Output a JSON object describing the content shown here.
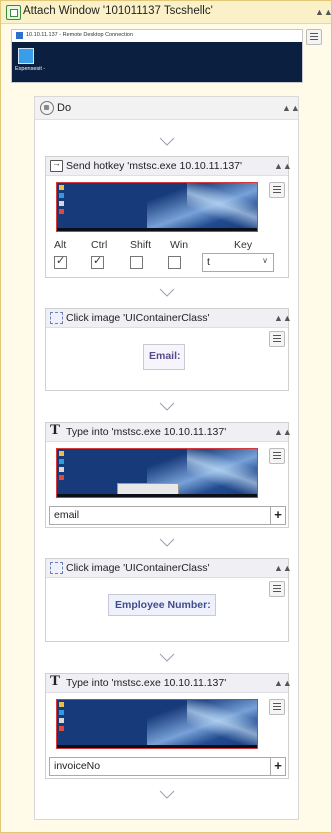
{
  "attach_window": {
    "title": "Attach Window '101011137 Tscshellc'",
    "rdp": {
      "window_title": "10.10.11.137 - Remote Desktop Connection",
      "app_label": "Expensesit -"
    }
  },
  "do": {
    "title": "Do",
    "send_hotkey": {
      "title": "Send hotkey 'mstsc.exe 10.10.11.137'",
      "modifiers": [
        {
          "label": "Alt",
          "checked": true
        },
        {
          "label": "Ctrl",
          "checked": true
        },
        {
          "label": "Shift",
          "checked": false
        },
        {
          "label": "Win",
          "checked": false
        }
      ],
      "key_label": "Key",
      "key_value": "t"
    },
    "click_image_1": {
      "title": "Click image 'UIContainerClass'",
      "target_text": "Email:"
    },
    "type_into_1": {
      "title": "Type into 'mstsc.exe 10.10.11.137'",
      "value": "email",
      "plus": "+"
    },
    "click_image_2": {
      "title": "Click image 'UIContainerClass'",
      "target_text": "Employee Number:"
    },
    "type_into_2": {
      "title": "Type into 'mstsc.exe 10.10.11.137'",
      "value": "invoiceNo",
      "plus": "+"
    }
  }
}
